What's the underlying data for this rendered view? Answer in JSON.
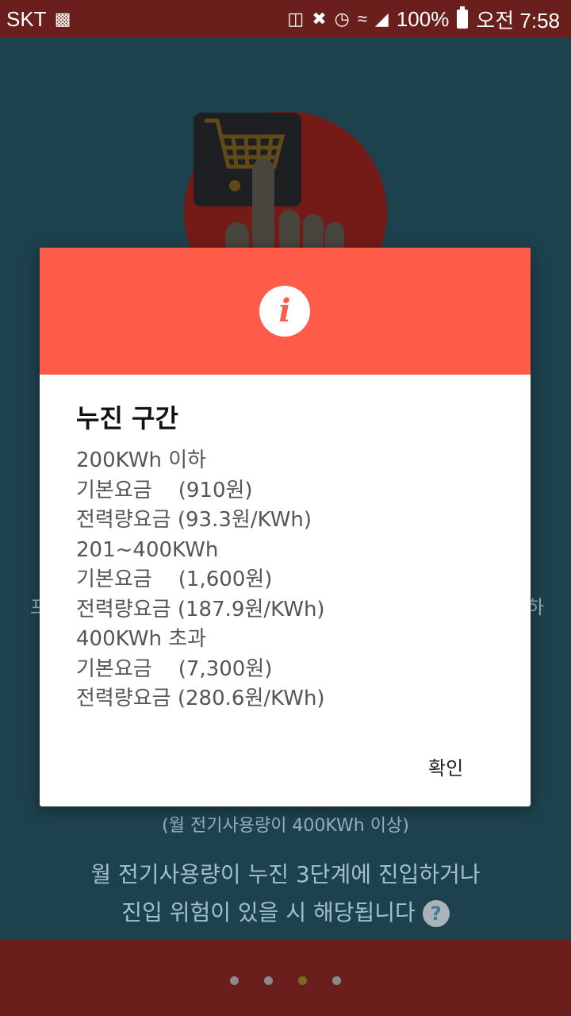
{
  "status_bar": {
    "carrier": "SKT",
    "battery": "100%",
    "time": "오전 7:58",
    "icons": [
      "video-icon",
      "cast-icon",
      "mute-icon",
      "alarm-icon",
      "wifi-icon",
      "signal-icon",
      "battery-icon"
    ]
  },
  "background": {
    "edge_left": "프",
    "edge_right": "하",
    "sub_text": "(월 전기사용량이 400KWh 이상)",
    "main_line1": "월 전기사용량이 누진 3단계에 진입하거나",
    "main_line2": "진입 위험이 있을 시 해당됩니다",
    "help_icon": "?"
  },
  "dialog": {
    "header_icon": "i",
    "title": "누진 구간",
    "lines": [
      "200KWh 이하",
      "기본요금    (910원)",
      "전력량요금 (93.3원/KWh)",
      "201~400KWh",
      "기본요금    (1,600원)",
      "전력량요금 (187.9원/KWh)",
      "400KWh 초과",
      "기본요금    (7,300원)",
      "전력량요금 (280.6원/KWh)"
    ],
    "confirm_label": "확인"
  },
  "pager": {
    "count": 4,
    "active_index": 2
  },
  "colors": {
    "status_bar": "#6a1f1c",
    "dialog_header": "#ff5b49",
    "background": "#3a7f95"
  }
}
